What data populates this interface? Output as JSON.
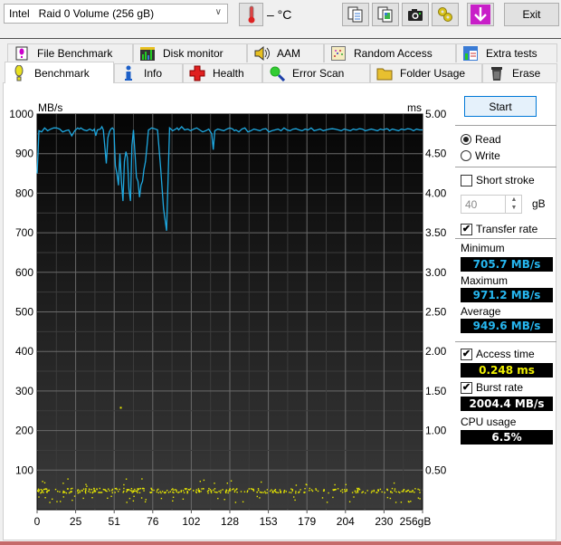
{
  "toolbar": {
    "drive_select_value": "Intel   Raid 0 Volume (256 gB)",
    "temperature": "– °C",
    "icons": [
      "copy-text-icon",
      "copy-image-icon",
      "screenshot-camera-icon",
      "options-gears-icon",
      "save-down-arrow-icon"
    ],
    "exit_label": "Exit"
  },
  "tabs_row1": [
    {
      "label": "File Benchmark",
      "icon": "file-benchmark-icon"
    },
    {
      "label": "Disk monitor",
      "icon": "disk-monitor-icon"
    },
    {
      "label": "AAM",
      "icon": "speaker-icon"
    },
    {
      "label": "Random Access",
      "icon": "random-access-icon"
    },
    {
      "label": "Extra tests",
      "icon": "extra-tests-icon"
    }
  ],
  "tabs_row2": [
    {
      "label": "Benchmark",
      "icon": "exclamation-bulb-icon",
      "active": true
    },
    {
      "label": "Info",
      "icon": "info-icon"
    },
    {
      "label": "Health",
      "icon": "red-cross-icon"
    },
    {
      "label": "Error Scan",
      "icon": "magnifier-icon"
    },
    {
      "label": "Folder Usage",
      "icon": "folder-icon"
    },
    {
      "label": "Erase",
      "icon": "trash-icon"
    }
  ],
  "controls": {
    "start_label": "Start",
    "read_label": "Read",
    "write_label": "Write",
    "mode_selected": "Read",
    "short_stroke_label": "Short stroke",
    "short_stroke_checked": false,
    "short_stroke_value": "40",
    "short_stroke_unit": "gB",
    "transfer_rate_label": "Transfer rate",
    "transfer_rate_checked": true,
    "minimum_label": "Minimum",
    "minimum_value": "705.7 MB/s",
    "maximum_label": "Maximum",
    "maximum_value": "971.2 MB/s",
    "average_label": "Average",
    "average_value": "949.6 MB/s",
    "access_time_label": "Access time",
    "access_time_checked": true,
    "access_time_value": "0.248 ms",
    "burst_rate_label": "Burst rate",
    "burst_rate_checked": true,
    "burst_rate_value": "2004.4 MB/s",
    "cpu_usage_label": "CPU usage",
    "cpu_usage_value": "6.5%"
  },
  "colors": {
    "transfer_line": "#1ea8e0",
    "access_points": "#e8e800",
    "readout_blue": "#26b7f0",
    "readout_yellow": "#f0f000",
    "readout_white": "#ffffff"
  },
  "chart_data": {
    "type": "line",
    "title": "",
    "ylabel_left": "MB/s",
    "ylabel_right": "ms",
    "xlabel": "gB",
    "xlim": [
      0,
      256
    ],
    "ylim_left": [
      0,
      1000
    ],
    "ylim_right": [
      0,
      5
    ],
    "x_ticks": [
      "0",
      "25",
      "51",
      "76",
      "102",
      "128",
      "153",
      "179",
      "204",
      "230",
      "256gB"
    ],
    "y_ticks_left": [
      "100",
      "200",
      "300",
      "400",
      "500",
      "600",
      "700",
      "800",
      "900",
      "1000"
    ],
    "y_ticks_right": [
      "0.50",
      "1.00",
      "1.50",
      "2.00",
      "2.50",
      "3.00",
      "3.50",
      "4.00",
      "4.50",
      "5.00"
    ],
    "grid": true,
    "series": [
      {
        "name": "Transfer rate (MB/s)",
        "x": [
          0,
          0.6,
          1.2,
          3,
          5,
          7,
          9,
          11,
          13,
          15,
          17,
          19,
          21,
          23,
          25,
          27,
          28,
          29,
          31,
          33,
          35,
          37,
          38,
          39,
          40,
          42,
          43,
          44,
          46,
          47,
          48,
          49,
          50,
          51,
          52,
          53,
          54,
          55,
          56,
          57,
          58,
          59,
          60,
          61,
          62,
          63,
          64,
          65,
          66,
          67,
          68,
          69,
          70,
          71,
          72,
          73,
          74,
          75,
          76,
          78,
          80,
          82,
          84,
          86,
          88,
          90,
          92,
          93,
          94,
          96,
          98,
          100,
          102,
          104,
          106,
          108,
          110,
          112,
          114,
          116,
          117,
          118,
          120,
          122,
          124,
          126,
          128,
          130,
          131,
          132,
          134,
          136,
          138,
          140,
          142,
          144,
          146,
          148,
          150,
          152,
          154,
          156,
          158,
          160,
          162,
          164,
          166,
          168,
          170,
          172,
          174,
          176,
          178,
          180,
          182,
          184,
          186,
          188,
          190,
          192,
          194,
          196,
          198,
          200,
          202,
          204,
          206,
          208,
          210,
          212,
          214,
          216,
          218,
          220,
          222,
          224,
          226,
          228,
          230,
          232,
          233,
          234,
          236,
          238,
          240,
          242,
          244,
          246,
          248,
          250,
          252,
          254,
          256
        ],
        "y": [
          850,
          900,
          958,
          955,
          965,
          958,
          962,
          965,
          965,
          962,
          955,
          958,
          960,
          945,
          958,
          965,
          962,
          965,
          960,
          958,
          962,
          958,
          962,
          945,
          960,
          962,
          968,
          960,
          875,
          940,
          955,
          962,
          965,
          960,
          870,
          850,
          820,
          900,
          830,
          780,
          880,
          905,
          890,
          810,
          780,
          920,
          960,
          900,
          840,
          830,
          790,
          820,
          830,
          860,
          880,
          920,
          960,
          962,
          965,
          963,
          960,
          865,
          760,
          705,
          965,
          958,
          962,
          965,
          960,
          968,
          960,
          962,
          958,
          962,
          965,
          960,
          955,
          958,
          962,
          950,
          910,
          958,
          962,
          960,
          958,
          962,
          965,
          962,
          958,
          960,
          955,
          962,
          965,
          955,
          958,
          962,
          960,
          958,
          962,
          963,
          955,
          958,
          960,
          962,
          958,
          965,
          960,
          958,
          962,
          963,
          960,
          958,
          962,
          960,
          965,
          958,
          960,
          962,
          958,
          960,
          962,
          963,
          962,
          960,
          958,
          962,
          960,
          958,
          962,
          960,
          963,
          962,
          958,
          960,
          962,
          960,
          958,
          962,
          960,
          963,
          962,
          958,
          962,
          960,
          958,
          962,
          960,
          963,
          962,
          958,
          962,
          960,
          960
        ]
      },
      {
        "name": "Access time (ms)",
        "type": "scatter",
        "typical_value_ms": 0.248,
        "band_ms": [
          0.1,
          0.4
        ],
        "outliers": [
          {
            "x": 55,
            "y": 1.3
          }
        ]
      }
    ]
  }
}
